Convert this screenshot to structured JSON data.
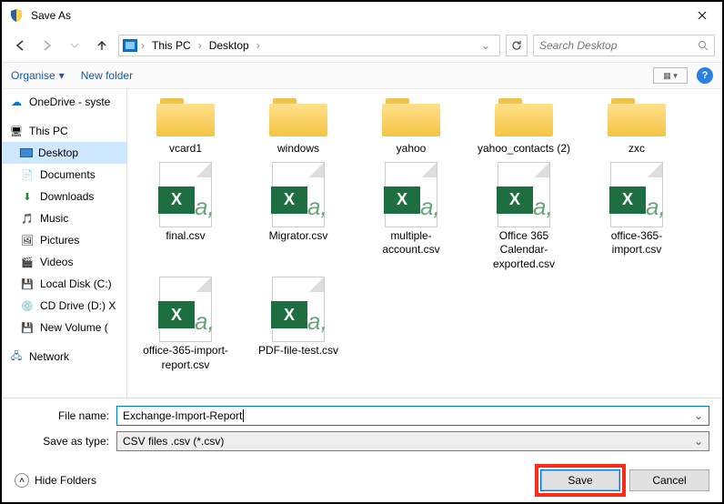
{
  "title": "Save As",
  "breadcrumb": [
    "This PC",
    "Desktop"
  ],
  "search_placeholder": "Search Desktop",
  "toolbar": {
    "organise": "Organise",
    "new_folder": "New folder"
  },
  "sidebar": {
    "onedrive": "OneDrive - syste",
    "this_pc": "This PC",
    "desktop": "Desktop",
    "documents": "Documents",
    "downloads": "Downloads",
    "music": "Music",
    "pictures": "Pictures",
    "videos": "Videos",
    "local_disk": "Local Disk (C:)",
    "cd_drive": "CD Drive (D:) X",
    "new_volume": "New Volume (",
    "network": "Network"
  },
  "folders": [
    {
      "name": "vcard1"
    },
    {
      "name": "windows"
    },
    {
      "name": "yahoo"
    },
    {
      "name": "yahoo_contacts (2)"
    },
    {
      "name": "zxc"
    }
  ],
  "files": [
    {
      "name": "final.csv"
    },
    {
      "name": "Migrator.csv"
    },
    {
      "name": "multiple-account.csv"
    },
    {
      "name": "Office 365 Calendar-exported.csv"
    },
    {
      "name": "office-365-import.csv"
    },
    {
      "name": "office-365-import-report.csv"
    },
    {
      "name": "PDF-file-test.csv"
    }
  ],
  "filename_label": "File name:",
  "filename_value": "Exchange-Import-Report",
  "type_label": "Save as type:",
  "type_value": "CSV files .csv (*.csv)",
  "hide_folders": "Hide Folders",
  "save_label": "Save",
  "cancel_label": "Cancel"
}
